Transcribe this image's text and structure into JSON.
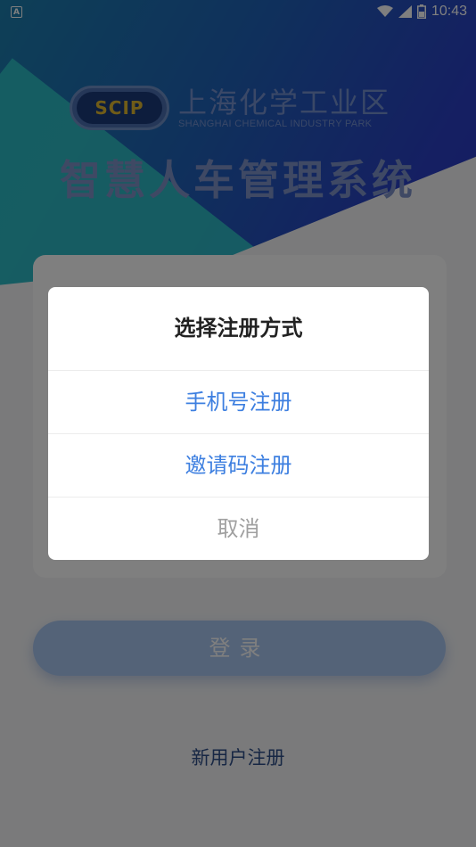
{
  "status_bar": {
    "time": "10:43",
    "left_icon_label": "A",
    "icons": [
      "wifi-icon",
      "signal-icon",
      "battery-icon"
    ]
  },
  "brand": {
    "logo_text": "SCIP",
    "name_cn": "上海化学工业区",
    "name_en": "SHANGHAI CHEMICAL INDUSTRY PARK",
    "app_title": "智慧人车管理系统"
  },
  "login": {
    "button_label": "登录",
    "register_link": "新用户注册"
  },
  "dialog": {
    "title": "选择注册方式",
    "options": [
      {
        "label": "手机号注册"
      },
      {
        "label": "邀请码注册"
      }
    ],
    "cancel_label": "取消"
  },
  "colors": {
    "accent": "#3d7fe0",
    "hero_start": "#1c7fae",
    "hero_end": "#2b36c2",
    "teal": "#2ec2c7",
    "login_button": "#a9c6f1"
  }
}
